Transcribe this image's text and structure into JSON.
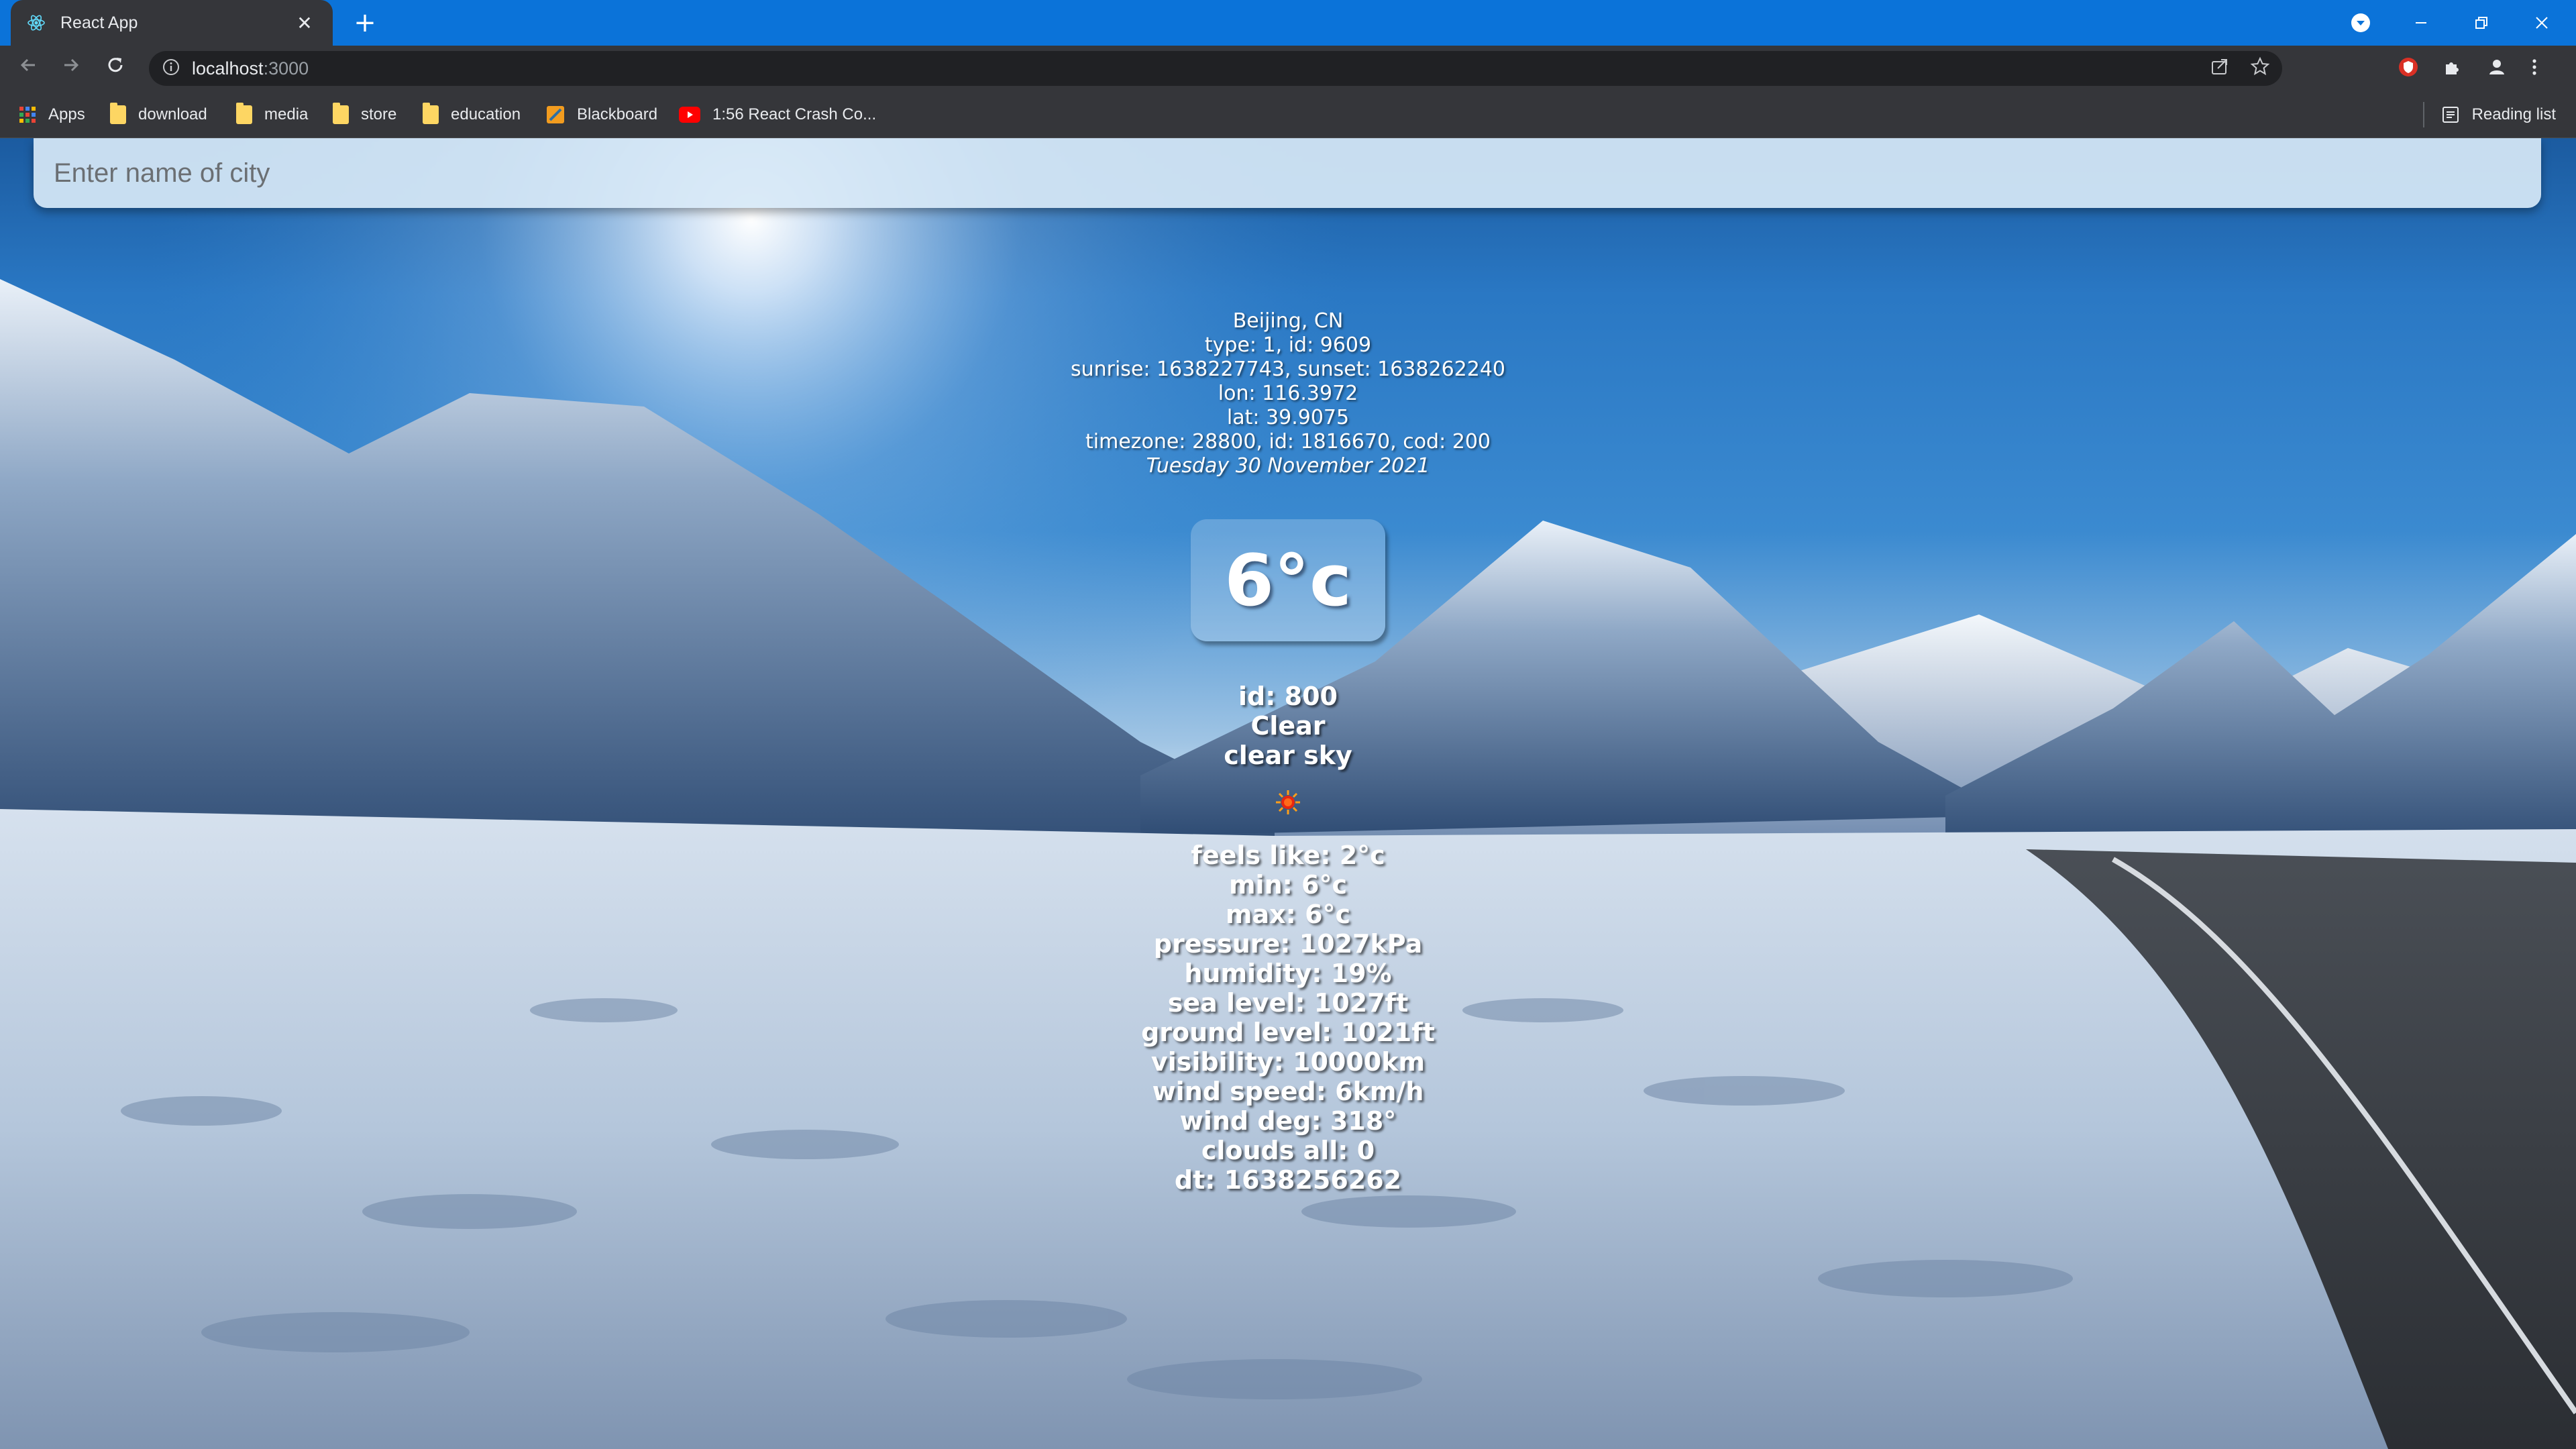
{
  "browser": {
    "tab_title": "React App",
    "tab_close": "✕",
    "new_tab": "+",
    "url_host": "localhost",
    "url_port": ":3000",
    "bookmarks": [
      {
        "label": "Apps"
      },
      {
        "label": "download"
      },
      {
        "label": "media"
      },
      {
        "label": "store"
      },
      {
        "label": "education"
      },
      {
        "label": "Blackboard"
      },
      {
        "label": "1:56 React Crash Co..."
      }
    ],
    "reading_list": "Reading list",
    "colors": {
      "tabstrip": "#0b73d9",
      "toolbar": "#35363a",
      "omnibox": "#202124"
    }
  },
  "search": {
    "placeholder": "Enter name of city"
  },
  "weather": {
    "location": "Beijing, CN",
    "sys_line": "type: 1, id: 9609",
    "sun_line": "sunrise: 1638227743, sunset: 1638262240",
    "lon_line": "lon: 116.3972",
    "lat_line": "lat: 39.9075",
    "tz_line": "timezone: 28800, id: 1816670, cod: 200",
    "date": "Tuesday 30 November 2021",
    "temperature": "6°c",
    "condition_id": "id: 800",
    "condition_main": "Clear",
    "condition_desc": "clear sky",
    "icon": "sun-icon",
    "details": [
      "feels like: 2°c",
      "min: 6°c",
      "max: 6°c",
      "pressure: 1027kPa",
      "humidity: 19%",
      "sea level: 1027ft",
      "ground level: 1021ft",
      "visibility: 10000km",
      "wind speed: 6km/h",
      "wind deg: 318°",
      "clouds all: 0",
      "dt: 1638256262"
    ]
  }
}
